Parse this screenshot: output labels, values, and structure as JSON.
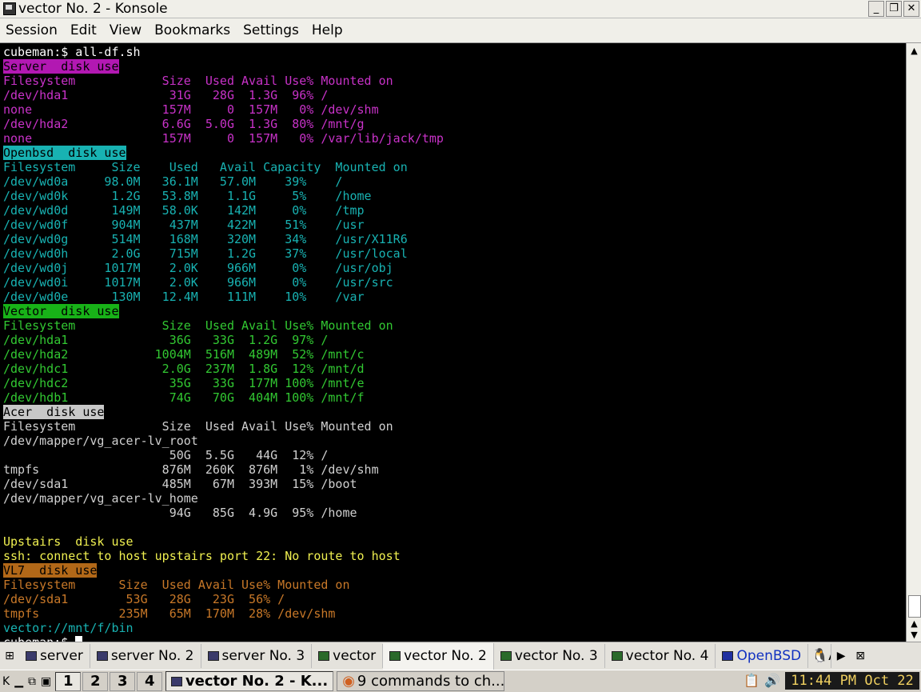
{
  "window": {
    "title": "vector No. 2 - Konsole",
    "minimize": "_",
    "maximize": "❐",
    "close": "✕"
  },
  "menu": [
    "Session",
    "Edit",
    "View",
    "Bookmarks",
    "Settings",
    "Help"
  ],
  "terminal": {
    "prompt": "cubeman:$ all-df.sh",
    "server": {
      "header": "Server  disk use",
      "cols": "Filesystem            Size  Used Avail Use% Mounted on",
      "rows": [
        "/dev/hda1              31G   28G  1.3G  96% /",
        "none                  157M     0  157M   0% /dev/shm",
        "/dev/hda2             6.6G  5.0G  1.3G  80% /mnt/g",
        "none                  157M     0  157M   0% /var/lib/jack/tmp"
      ]
    },
    "openbsd": {
      "header": "Openbsd  disk use",
      "cols": "Filesystem     Size    Used   Avail Capacity  Mounted on",
      "rows": [
        "/dev/wd0a     98.0M   36.1M   57.0M    39%    /",
        "/dev/wd0k      1.2G   53.8M    1.1G     5%    /home",
        "/dev/wd0d      149M   58.0K    142M     0%    /tmp",
        "/dev/wd0f      904M    437M    422M    51%    /usr",
        "/dev/wd0g      514M    168M    320M    34%    /usr/X11R6",
        "/dev/wd0h      2.0G    715M    1.2G    37%    /usr/local",
        "/dev/wd0j     1017M    2.0K    966M     0%    /usr/obj",
        "/dev/wd0i     1017M    2.0K    966M     0%    /usr/src",
        "/dev/wd0e      130M   12.4M    111M    10%    /var"
      ]
    },
    "vector": {
      "header": "Vector  disk use",
      "cols": "Filesystem            Size  Used Avail Use% Mounted on",
      "rows": [
        "/dev/hda1              36G   33G  1.2G  97% /",
        "/dev/hda2            1004M  516M  489M  52% /mnt/c",
        "/dev/hdc1             2.0G  237M  1.8G  12% /mnt/d",
        "/dev/hdc2              35G   33G  177M 100% /mnt/e",
        "/dev/hdb1              74G   70G  404M 100% /mnt/f"
      ]
    },
    "acer": {
      "header": "Acer  disk use",
      "cols": "Filesystem            Size  Used Avail Use% Mounted on",
      "rows": [
        "/dev/mapper/vg_acer-lv_root",
        "                       50G  5.5G   44G  12% /",
        "tmpfs                 876M  260K  876M   1% /dev/shm",
        "/dev/sda1             485M   67M  393M  15% /boot",
        "/dev/mapper/vg_acer-lv_home",
        "                       94G   85G  4.9G  95% /home"
      ]
    },
    "upstairs": {
      "header": "Upstairs  disk use",
      "error": "ssh: connect to host upstairs port 22: No route to host"
    },
    "vl7": {
      "header": "VL7  disk use",
      "cols": "Filesystem      Size  Used Avail Use% Mounted on",
      "rows": [
        "/dev/sda1        53G   28G   23G  56% /",
        "tmpfs           235M   65M  170M  28% /dev/shm"
      ]
    },
    "path_line": "vector://mnt/f/bin",
    "final_prompt": "cubeman:$ "
  },
  "tabs": [
    {
      "label": "server",
      "icon": "konsole-icon",
      "active": false
    },
    {
      "label": "server No. 2",
      "icon": "konsole-icon",
      "active": false
    },
    {
      "label": "server No. 3",
      "icon": "konsole-icon",
      "active": false
    },
    {
      "label": "vector",
      "icon": "konsole-icon",
      "active": false
    },
    {
      "label": "vector No. 2",
      "icon": "konsole-icon",
      "active": true
    },
    {
      "label": "vector No. 3",
      "icon": "konsole-icon",
      "active": false
    },
    {
      "label": "vector No. 4",
      "icon": "konsole-icon",
      "active": false
    },
    {
      "label": "OpenBSD",
      "icon": "konsole-icon",
      "active": false
    },
    {
      "label": "A",
      "icon": "linux-icon",
      "active": false
    }
  ],
  "taskbar": {
    "desktops": [
      "1",
      "2",
      "3",
      "4"
    ],
    "active_desktop": "1",
    "tasks": [
      {
        "label": "vector No. 2 - K...",
        "active": true
      },
      {
        "label": "9 commands to ch...",
        "active": false
      }
    ],
    "clock": "11:44 PM Oct 22"
  }
}
